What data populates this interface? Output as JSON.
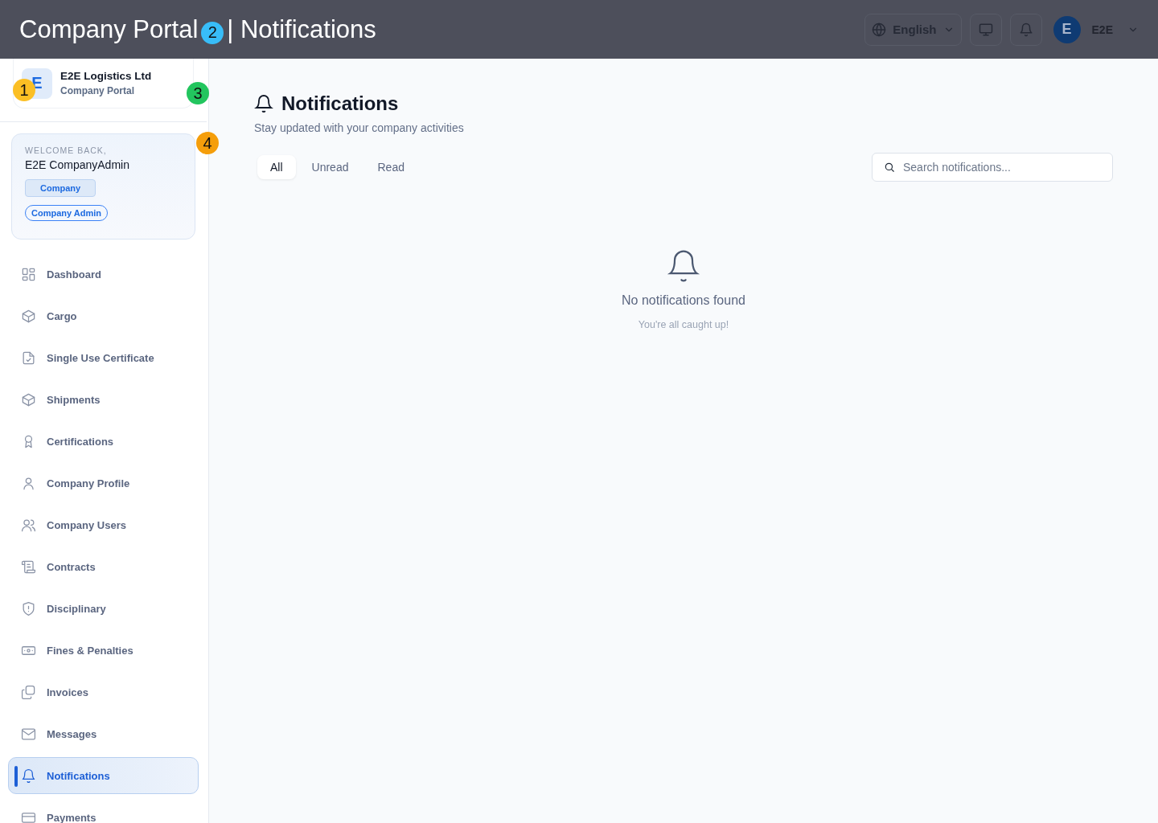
{
  "header": {
    "title": "Company Portal",
    "title_suffix": "| Notifications",
    "language": "English",
    "user": "E2E",
    "avatar": "E"
  },
  "markers": [
    {
      "label": "1",
      "color": "#fbbf24"
    },
    {
      "label": "2",
      "color": "#38bdf8"
    },
    {
      "label": "3",
      "color": "#22c55e"
    },
    {
      "label": "4",
      "color": "#f59e0b"
    }
  ],
  "company": {
    "logo": "E",
    "name": "E2E Logistics Ltd",
    "subtitle": "Company Portal"
  },
  "welcome": {
    "greeting": "WELCOME BACK,",
    "name": "E2E CompanyAdmin",
    "badges": [
      "Company",
      "Company Admin"
    ]
  },
  "sidebar": {
    "items": [
      {
        "label": "Dashboard",
        "selected": false
      },
      {
        "label": "Cargo",
        "selected": false
      },
      {
        "label": "Single Use Certificate",
        "selected": false
      },
      {
        "label": "Shipments",
        "selected": false
      },
      {
        "label": "Certifications",
        "selected": false
      },
      {
        "label": "Company Profile",
        "selected": false
      },
      {
        "label": "Company Users",
        "selected": false
      },
      {
        "label": "Contracts",
        "selected": false
      },
      {
        "label": "Disciplinary",
        "selected": false
      },
      {
        "label": "Fines & Penalties",
        "selected": false
      },
      {
        "label": "Invoices",
        "selected": false
      },
      {
        "label": "Messages",
        "selected": false
      },
      {
        "label": "Notifications",
        "selected": true
      },
      {
        "label": "Payments",
        "selected": false
      }
    ]
  },
  "page": {
    "title": "Notifications",
    "subtitle": "Stay updated with your company activities"
  },
  "tabs": [
    {
      "label": "All",
      "selected": true
    },
    {
      "label": "Unread",
      "selected": false
    },
    {
      "label": "Read",
      "selected": false
    }
  ],
  "search": {
    "placeholder": "Search notifications..."
  },
  "empty_state": {
    "title": "No notifications found",
    "message": "You're all caught up!"
  }
}
